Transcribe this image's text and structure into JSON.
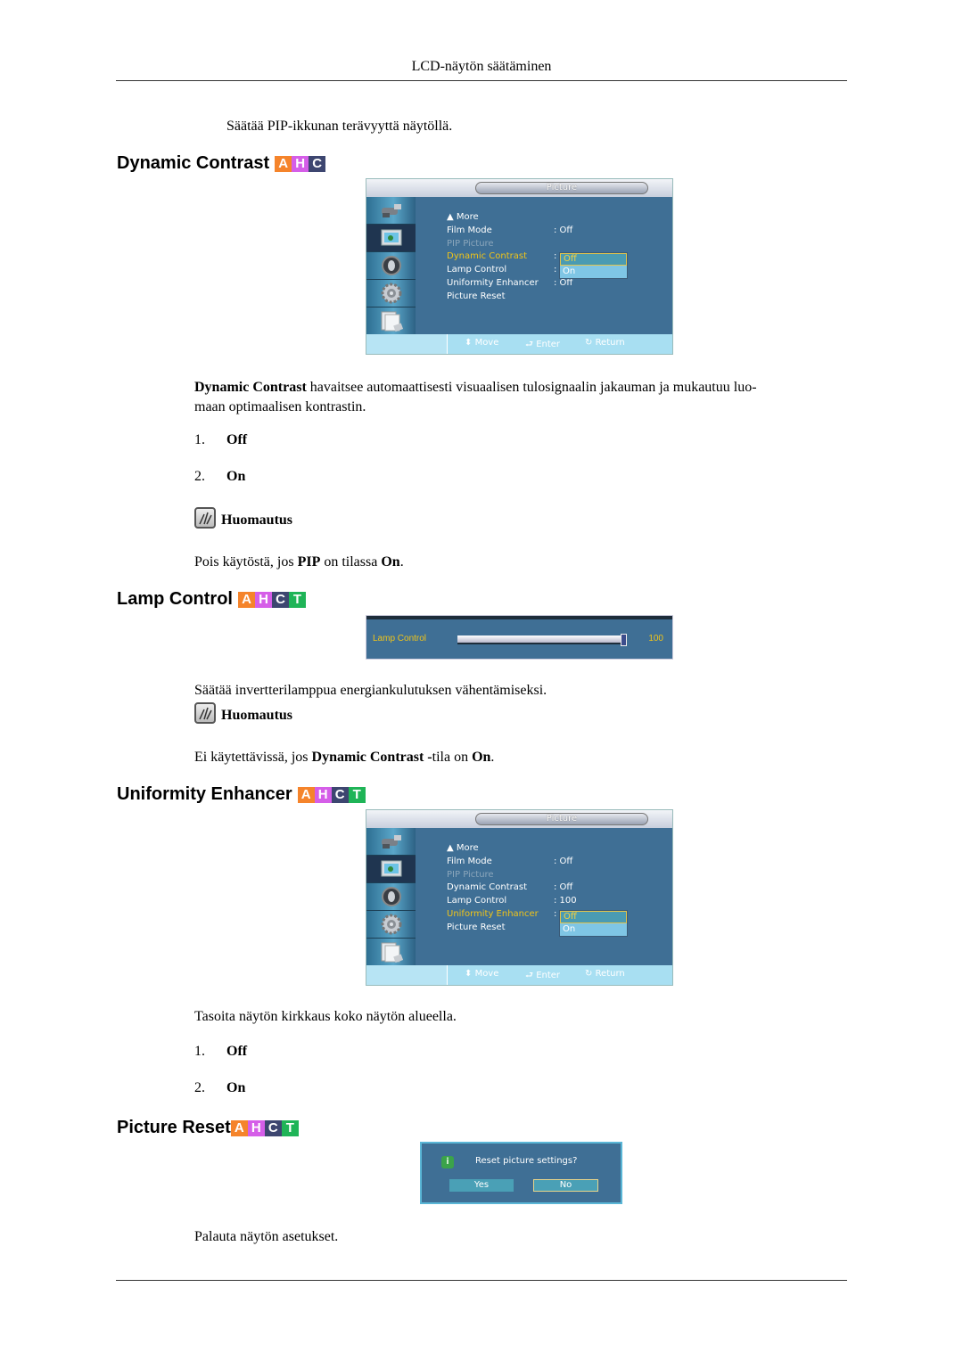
{
  "page": {
    "header": "LCD-näytön säätäminen",
    "intro": "Säätää PIP-ikkunan terävyyttä näytöllä."
  },
  "sections": {
    "dynamic_contrast": {
      "title": "Dynamic Contrast",
      "badges": [
        "A",
        "H",
        "C"
      ],
      "desc_bold": "Dynamic Contrast",
      "desc_line1_rest": " havaitsee automaattisesti visuaalisen tulosignaalin jakauman ja mukautuu luo-",
      "desc_line2": "maan optimaalisen kontrastin.",
      "options": [
        {
          "num": "1.",
          "label": "Off"
        },
        {
          "num": "2.",
          "label": "On"
        }
      ],
      "note_label": "Huomautus",
      "note_text_parts": [
        "Pois käytöstä, jos ",
        "PIP",
        " on tilassa ",
        "On",
        "."
      ]
    },
    "lamp_control": {
      "title": "Lamp Control",
      "badges": [
        "A",
        "H",
        "C",
        "T"
      ],
      "desc": "Säätää invertterilamppua energiankulutuksen vähentämiseksi.",
      "note_label": "Huomautus",
      "note_text_parts": [
        "Ei käytettävissä, jos ",
        "Dynamic Contrast",
        " -",
        "tila on ",
        "On",
        "."
      ]
    },
    "uniformity_enhancer": {
      "title": "Uniformity Enhancer",
      "badges": [
        "A",
        "H",
        "C",
        "T"
      ],
      "desc": "Tasoita näytön kirkkaus koko näytön alueella.",
      "options": [
        {
          "num": "1.",
          "label": "Off"
        },
        {
          "num": "2.",
          "label": "On"
        }
      ]
    },
    "picture_reset": {
      "title": "Picture Reset",
      "badges": [
        "A",
        "H",
        "C",
        "T"
      ],
      "desc": "Palauta näytön asetukset."
    }
  },
  "osd_menu_1": {
    "title": "Picture",
    "sidebar_icons": [
      "input-icon",
      "picture-icon",
      "sound-icon",
      "setup-icon",
      "multi-control-icon"
    ],
    "selected_sidebar": 1,
    "rows": [
      {
        "label": "▲  More",
        "value": ""
      },
      {
        "label": "Film Mode",
        "value": ": Off"
      },
      {
        "label": "PIP Picture",
        "value": "",
        "state": "disabled"
      },
      {
        "label": "Dynamic Contrast",
        "value": ":",
        "state": "highlighted"
      },
      {
        "label": "Lamp Control",
        "value": ":"
      },
      {
        "label": "Uniformity Enhancer",
        "value": ": Off"
      },
      {
        "label": "Picture Reset",
        "value": ""
      }
    ],
    "dropdown": {
      "options": [
        "Off",
        "On"
      ],
      "selected": "Off"
    },
    "nav": {
      "move": "Move",
      "enter": "Enter",
      "return": "Return"
    }
  },
  "lamp_osd": {
    "label": "Lamp Control",
    "value": "100",
    "fill_percent": 100
  },
  "osd_menu_2": {
    "title": "Picture",
    "sidebar_icons": [
      "input-icon",
      "picture-icon",
      "sound-icon",
      "setup-icon",
      "multi-control-icon"
    ],
    "selected_sidebar": 1,
    "rows": [
      {
        "label": "▲  More",
        "value": ""
      },
      {
        "label": "Film Mode",
        "value": ": Off"
      },
      {
        "label": "PIP Picture",
        "value": "",
        "state": "disabled"
      },
      {
        "label": "Dynamic Contrast",
        "value": ": Off"
      },
      {
        "label": "Lamp Control",
        "value": ": 100"
      },
      {
        "label": "Uniformity Enhancer",
        "value": ":",
        "state": "highlighted"
      },
      {
        "label": "Picture Reset",
        "value": ""
      }
    ],
    "dropdown": {
      "options": [
        "Off",
        "On"
      ],
      "selected": "Off"
    },
    "nav": {
      "move": "Move",
      "enter": "Enter",
      "return": "Return"
    }
  },
  "reset_dialog": {
    "question": "Reset picture settings?",
    "yes": "Yes",
    "no": "No",
    "selected": "No"
  },
  "colors": {
    "badge_A": "#f5842b",
    "badge_H": "#d55ee8",
    "badge_C": "#3d4670",
    "badge_T": "#1fb457",
    "osd_bg": "#3f6f95",
    "osd_highlight": "#f0c419"
  }
}
